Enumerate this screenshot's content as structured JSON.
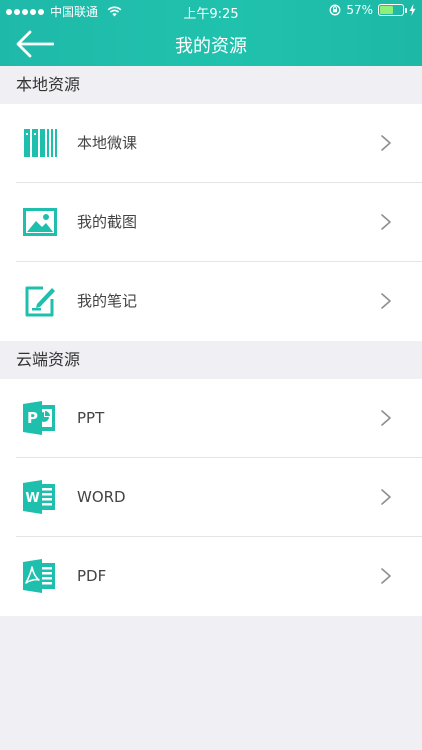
{
  "statusbar": {
    "carrier": "中国联通",
    "time": "上午9:25",
    "battery": "57%",
    "battery_level": 0.57
  },
  "navbar": {
    "title": "我的资源"
  },
  "sections": [
    {
      "title": "本地资源",
      "items": [
        {
          "label": "本地微课",
          "icon": "books-icon"
        },
        {
          "label": "我的截图",
          "icon": "image-icon"
        },
        {
          "label": "我的笔记",
          "icon": "note-icon"
        }
      ]
    },
    {
      "title": "云端资源",
      "items": [
        {
          "label": "PPT",
          "icon": "ppt-icon"
        },
        {
          "label": "WORD",
          "icon": "word-icon"
        },
        {
          "label": "PDF",
          "icon": "pdf-icon"
        }
      ]
    }
  ],
  "colors": {
    "accent": "#1fbfad",
    "background": "#efeff4"
  }
}
